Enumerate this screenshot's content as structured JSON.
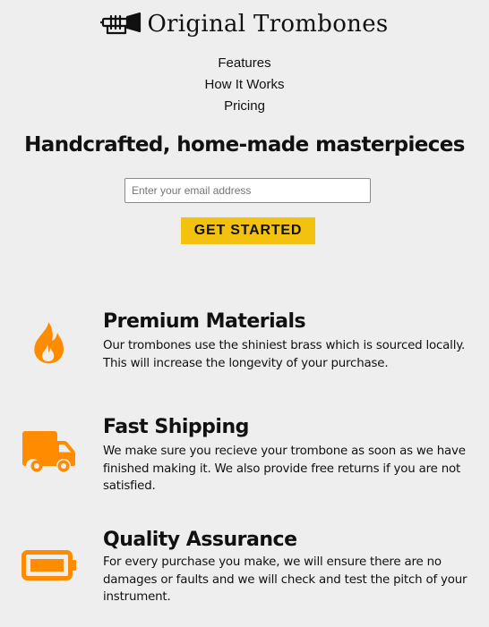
{
  "brand": {
    "name": "Original Trombones",
    "icon": "trombone-icon"
  },
  "nav": {
    "items": [
      {
        "label": "Features"
      },
      {
        "label": "How It Works"
      },
      {
        "label": "Pricing"
      }
    ]
  },
  "hero": {
    "title": "Handcrafted, home-made masterpieces",
    "email_placeholder": "Enter your email address",
    "email_value": "",
    "cta_label": "GET STARTED"
  },
  "features": [
    {
      "icon": "fire-icon",
      "title": "Premium Materials",
      "text": "Our trombones use the shiniest brass which is sourced locally. This will increase the longevity of your purchase."
    },
    {
      "icon": "truck-icon",
      "title": "Fast Shipping",
      "text": "We make sure you recieve your trombone as soon as we have finished making it. We also provide free returns if you are not satisfied."
    },
    {
      "icon": "battery-full-icon",
      "title": "Quality Assurance",
      "text": "For every purchase you make, we will ensure there are no damages or faults and we will check and test the pitch of your instrument."
    }
  ],
  "colors": {
    "background": "#eeeeee",
    "accent": "#f2c20f",
    "icon_orange": "#ff8c00",
    "text": "#111111"
  }
}
